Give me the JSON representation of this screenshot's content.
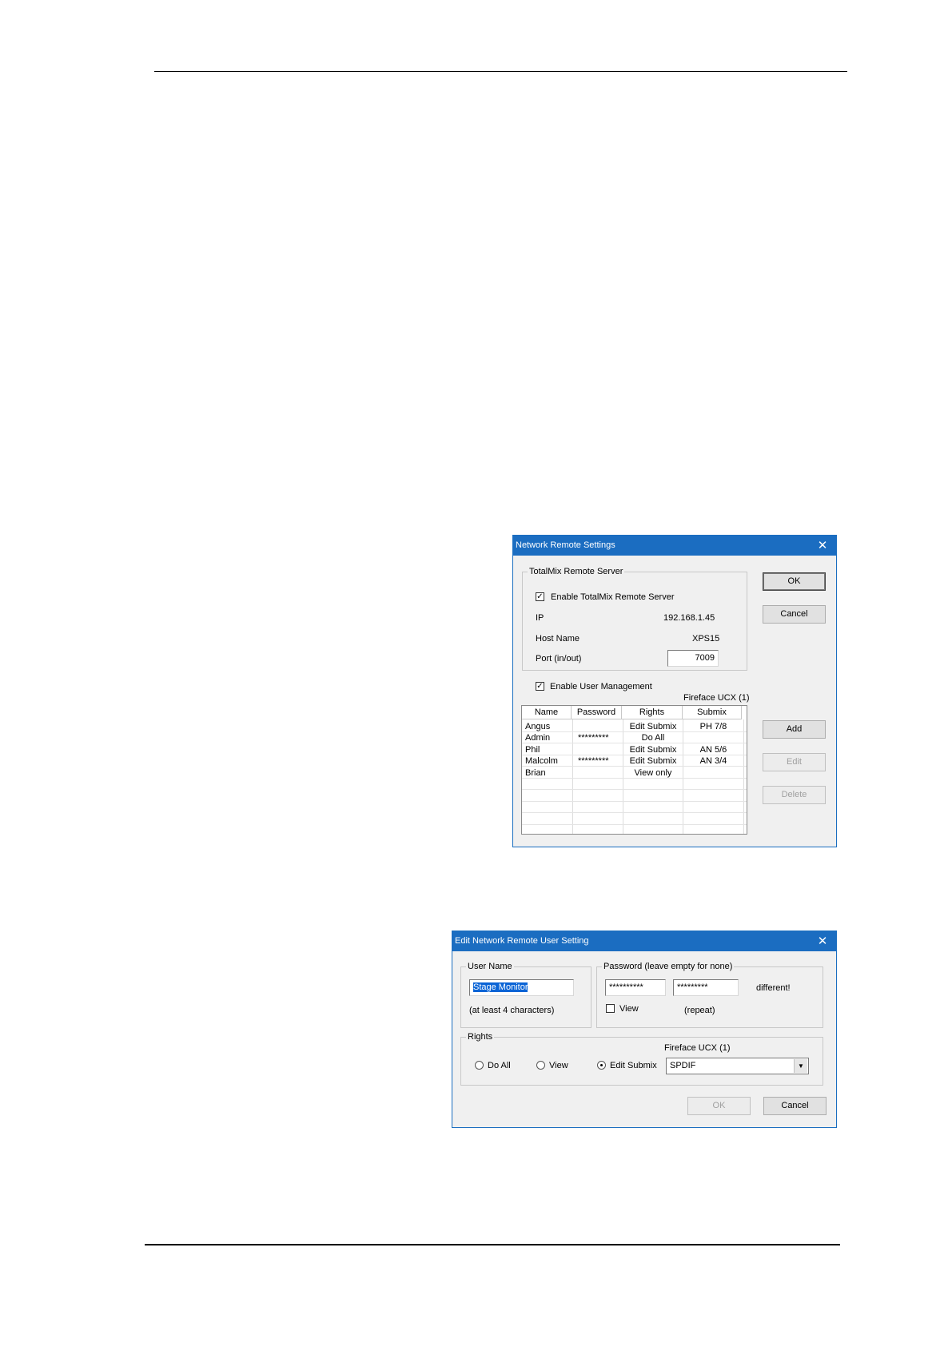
{
  "dialog1": {
    "title": "Network Remote Settings",
    "server_group": {
      "label": "TotalMix Remote Server",
      "enable_label": "Enable TotalMix Remote Server",
      "enable_checked": true,
      "ip_label": "IP",
      "ip_value": "192.168.1.45",
      "host_label": "Host Name",
      "host_value": "XPS15",
      "port_label": "Port (in/out)",
      "port_value": "7009"
    },
    "user_mgmt_label": "Enable User Management",
    "user_mgmt_checked": true,
    "device_label": "Fireface UCX (1)",
    "table": {
      "headers": [
        "Name",
        "Password",
        "Rights",
        "Submix"
      ],
      "rows": [
        {
          "name": "Angus",
          "password": "",
          "rights": "Edit Submix",
          "submix": "PH 7/8"
        },
        {
          "name": "Admin",
          "password": "*********",
          "rights": "Do All",
          "submix": ""
        },
        {
          "name": "Phil",
          "password": "",
          "rights": "Edit Submix",
          "submix": "AN 5/6"
        },
        {
          "name": "Malcolm",
          "password": "*********",
          "rights": "Edit Submix",
          "submix": "AN 3/4"
        },
        {
          "name": "Brian",
          "password": "",
          "rights": "View only",
          "submix": ""
        }
      ]
    },
    "buttons": {
      "ok": "OK",
      "cancel": "Cancel",
      "add": "Add",
      "edit": "Edit",
      "delete": "Delete"
    }
  },
  "dialog2": {
    "title": "Edit Network Remote User Setting",
    "user_group": {
      "label": "User Name",
      "value": "Stage Monitor",
      "hint": "(at least 4 characters)"
    },
    "password_group": {
      "label": "Password (leave empty for none)",
      "password_value": "**********",
      "repeat_value": "*********",
      "mismatch_text": "different!",
      "view_label": "View",
      "view_checked": false,
      "repeat_label": "(repeat)"
    },
    "rights_group": {
      "label": "Rights",
      "device_label": "Fireface UCX (1)",
      "options": [
        "Do All",
        "View",
        "Edit Submix"
      ],
      "selected": "Edit Submix",
      "submix_value": "SPDIF"
    },
    "buttons": {
      "ok": "OK",
      "cancel": "Cancel"
    }
  },
  "icons": {
    "close": "close-icon",
    "dropdown": "chevron-down-icon",
    "check": "checkmark-icon"
  }
}
